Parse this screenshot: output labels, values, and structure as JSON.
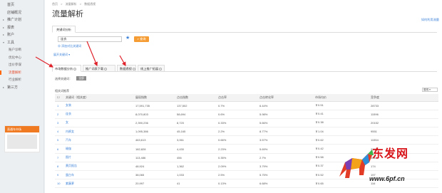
{
  "sidebar": {
    "items": [
      {
        "label": "首页",
        "type": "top"
      },
      {
        "label": "店铺概况",
        "type": "top"
      },
      {
        "label": "推广计划",
        "type": "group"
      },
      {
        "label": "报表",
        "type": "group"
      },
      {
        "label": "账户",
        "type": "group"
      },
      {
        "label": "工具",
        "type": "group-open"
      },
      {
        "label": "账户诊断",
        "type": "sub"
      },
      {
        "label": "优化中心",
        "type": "sub"
      },
      {
        "label": "出价参谋",
        "type": "sub"
      },
      {
        "label": "流量解析",
        "type": "sub-active"
      },
      {
        "label": "行业解析",
        "type": "sub"
      },
      {
        "label": "第三方",
        "type": "group"
      }
    ],
    "ad_header": "直通车市场"
  },
  "breadcrumb": [
    "首页",
    ">",
    "流量解析",
    ">",
    "数据透视"
  ],
  "page_title": "流量解析",
  "help_link": "如何利用流量",
  "subtab": "关键词分析",
  "search": {
    "value": "连衣",
    "button": "查询"
  },
  "links": {
    "add_compare": "添加对比关键词",
    "expand": "展开关键词 ▾"
  },
  "tabs": [
    {
      "label": "市场数据分析",
      "active": true
    },
    {
      "label": "推广词表下载",
      "active": false
    },
    {
      "label": "数据透视",
      "active": false
    },
    {
      "label": "线上推广拓展",
      "active": false
    }
  ],
  "filter": {
    "label": "选择关键词：",
    "button": "全部"
  },
  "keywords_label": "相关词推荐",
  "sort_select": "展现 ▾",
  "table": {
    "headers": [
      "",
      "关键词（相关度）",
      "展现指数",
      "点击指数",
      "点击率",
      "点击转化率",
      "市场均价",
      "竞争度"
    ],
    "rows": [
      [
        "1",
        "女装",
        "17,591,735",
        "137,502",
        "0.7%",
        "6.44%",
        "￥0.51",
        "28733"
      ],
      [
        "2",
        "连衣",
        "8,070,803",
        "58,694",
        "0.6%",
        "5.98%",
        "￥0.41",
        "11596"
      ],
      [
        "3",
        "女",
        "2,390,236",
        "8,720",
        "0.33%",
        "5.66%",
        "￥0.38",
        "20152"
      ],
      [
        "4",
        "内裤女",
        "1,095,386",
        "45,165",
        "2.2%",
        "8.77%",
        "￥1.04",
        "9551"
      ],
      [
        "5",
        "汽车",
        "463,613",
        "3,061",
        "0.66%",
        "3.57%",
        "￥0.62",
        "11554"
      ],
      [
        "6",
        "瑜伽",
        "182,828",
        "4,430",
        "2.23%",
        "5.69%",
        "￥0.42",
        "2238"
      ],
      [
        "7",
        "图片",
        "113,486",
        "456",
        "0.35%",
        "2.7%",
        "￥0.58",
        "1182"
      ],
      [
        "8",
        "黄页报告",
        "48,924",
        "1,362",
        "2.09%",
        "3.79%",
        "￥0.37",
        "174"
      ],
      [
        "9",
        "蛋白车",
        "38,065",
        "1,033",
        "2.5%",
        "5.75%",
        "￥0.52",
        "197"
      ],
      [
        "10",
        "紫藤萝",
        "20,997",
        "41",
        "0.13%",
        "6.68%",
        "￥0.65",
        "116"
      ]
    ]
  },
  "watermark": {
    "brand": "东发网",
    "url": "www.6pf.cn"
  },
  "colors": {
    "accent": "#f59d34",
    "link": "#3d82d8",
    "arrow": "#e0212a",
    "brand_red": "#d8171c"
  }
}
